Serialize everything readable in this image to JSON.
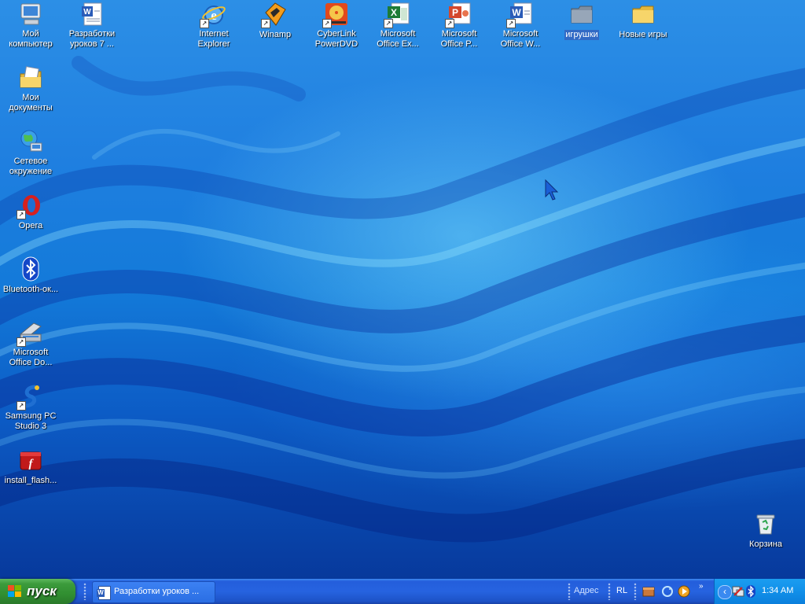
{
  "desktop_icons": [
    {
      "id": "my-computer",
      "label": "Мой\nкомпьютер",
      "icon": "my-computer-icon"
    },
    {
      "id": "lessons-doc",
      "label": "Разработки\nуроков 7 ...",
      "icon": "word-document-icon"
    },
    {
      "id": "internet-explorer",
      "label": "Internet\nExplorer",
      "icon": "internet-explorer-icon"
    },
    {
      "id": "winamp",
      "label": "Winamp",
      "icon": "winamp-icon"
    },
    {
      "id": "powerdvd",
      "label": "CyberLink\nPowerDVD",
      "icon": "powerdvd-icon"
    },
    {
      "id": "excel",
      "label": "Microsoft\nOffice Ex...",
      "icon": "excel-icon"
    },
    {
      "id": "powerpoint",
      "label": "Microsoft\nOffice P...",
      "icon": "powerpoint-icon"
    },
    {
      "id": "word",
      "label": "Microsoft\nOffice W...",
      "icon": "word-icon"
    },
    {
      "id": "games-folder",
      "label": "игрушки",
      "icon": "folder-icon"
    },
    {
      "id": "new-games",
      "label": "Новые игры",
      "icon": "folder-icon"
    },
    {
      "id": "my-documents",
      "label": "Мои\nдокументы",
      "icon": "my-documents-icon"
    },
    {
      "id": "network",
      "label": "Сетевое\nокружение",
      "icon": "network-places-icon"
    },
    {
      "id": "opera",
      "label": "Opera",
      "icon": "opera-icon"
    },
    {
      "id": "bluetooth",
      "label": "Bluetooth-ок...",
      "icon": "bluetooth-icon"
    },
    {
      "id": "office-doc-imaging",
      "label": "Microsoft\nOffice Do...",
      "icon": "scanner-icon"
    },
    {
      "id": "samsung-pc-studio",
      "label": "Samsung PC\nStudio 3",
      "icon": "samsung-pc-studio-icon"
    },
    {
      "id": "install-flash",
      "label": "install_flash...",
      "icon": "flash-installer-icon"
    },
    {
      "id": "recycle-bin",
      "label": "Корзина",
      "icon": "recycle-bin-icon"
    }
  ],
  "taskbar": {
    "start_label": "пуск",
    "open_task": "Разработки уроков ...",
    "address_label": "Адрес",
    "language": "RL",
    "chevron": "»",
    "clock": "1:34 AM"
  },
  "colors": {
    "selection": "#316ac5",
    "start_green": "#3c9b3c",
    "taskbar_blue": "#245edb",
    "tray_blue": "#1190e9"
  }
}
